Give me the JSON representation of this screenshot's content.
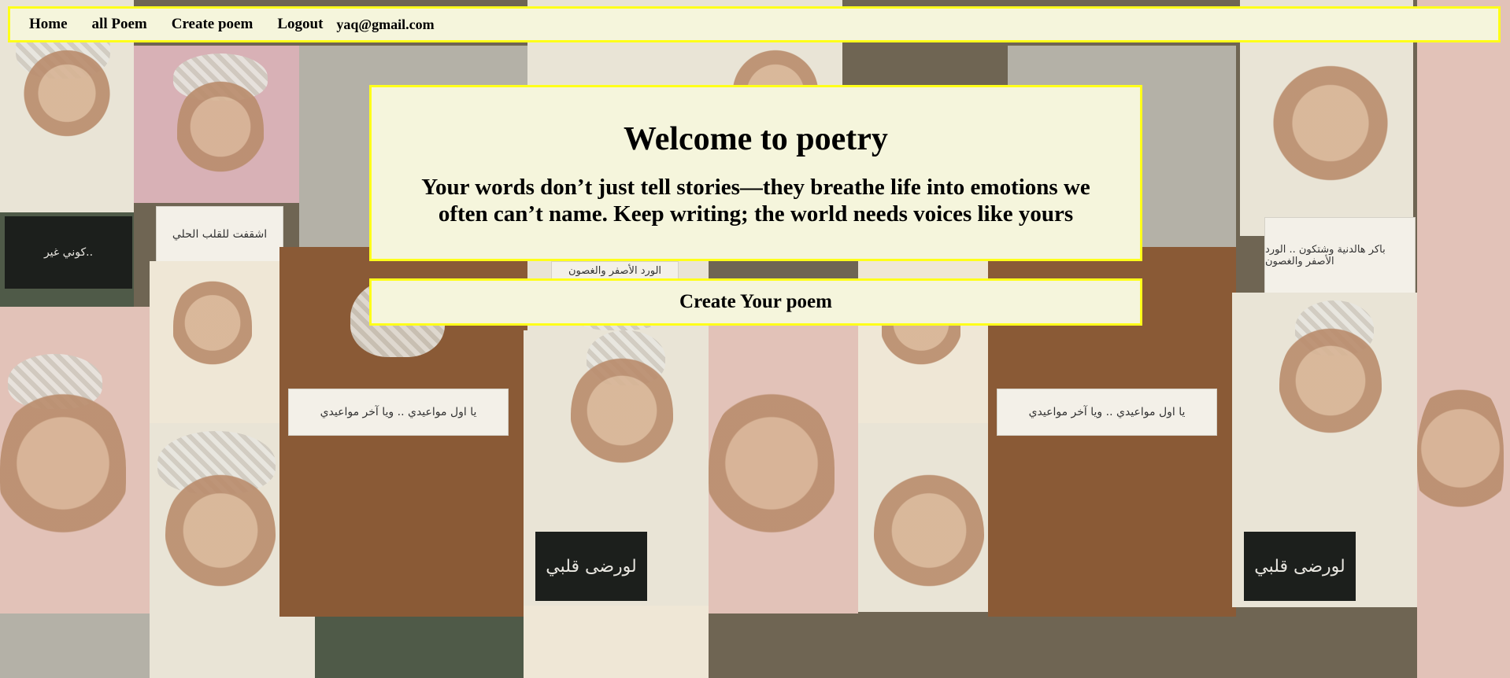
{
  "nav": {
    "home": "Home",
    "all_poem": "all Poem",
    "create_poem": "Create poem",
    "logout": "Logout",
    "user_email": "yaq@gmail.com"
  },
  "welcome": {
    "title": "Welcome to poetry",
    "message": "Your words don’t just tell stories—they breathe life into emotions we often can’t name. Keep writing; the world needs voices like yours"
  },
  "cta": {
    "label": "Create Your poem"
  },
  "background": {
    "notes": [
      "كوني غير..",
      "اشقفت للقلب الحلي",
      "يا اول مواعيدي .. ويا آخر مواعيدي",
      "لورضى قلبي",
      "الورد الأصفر والغصون",
      "يا اول مواعيدي .. ويا آخر مواعيدي",
      "لورضى قلبي",
      "باكر هالدنية وشتكون .. الورد الأصفر والغصون"
    ]
  },
  "colors": {
    "panel_bg": "#f5f5dc",
    "panel_border": "#ffff1a"
  }
}
